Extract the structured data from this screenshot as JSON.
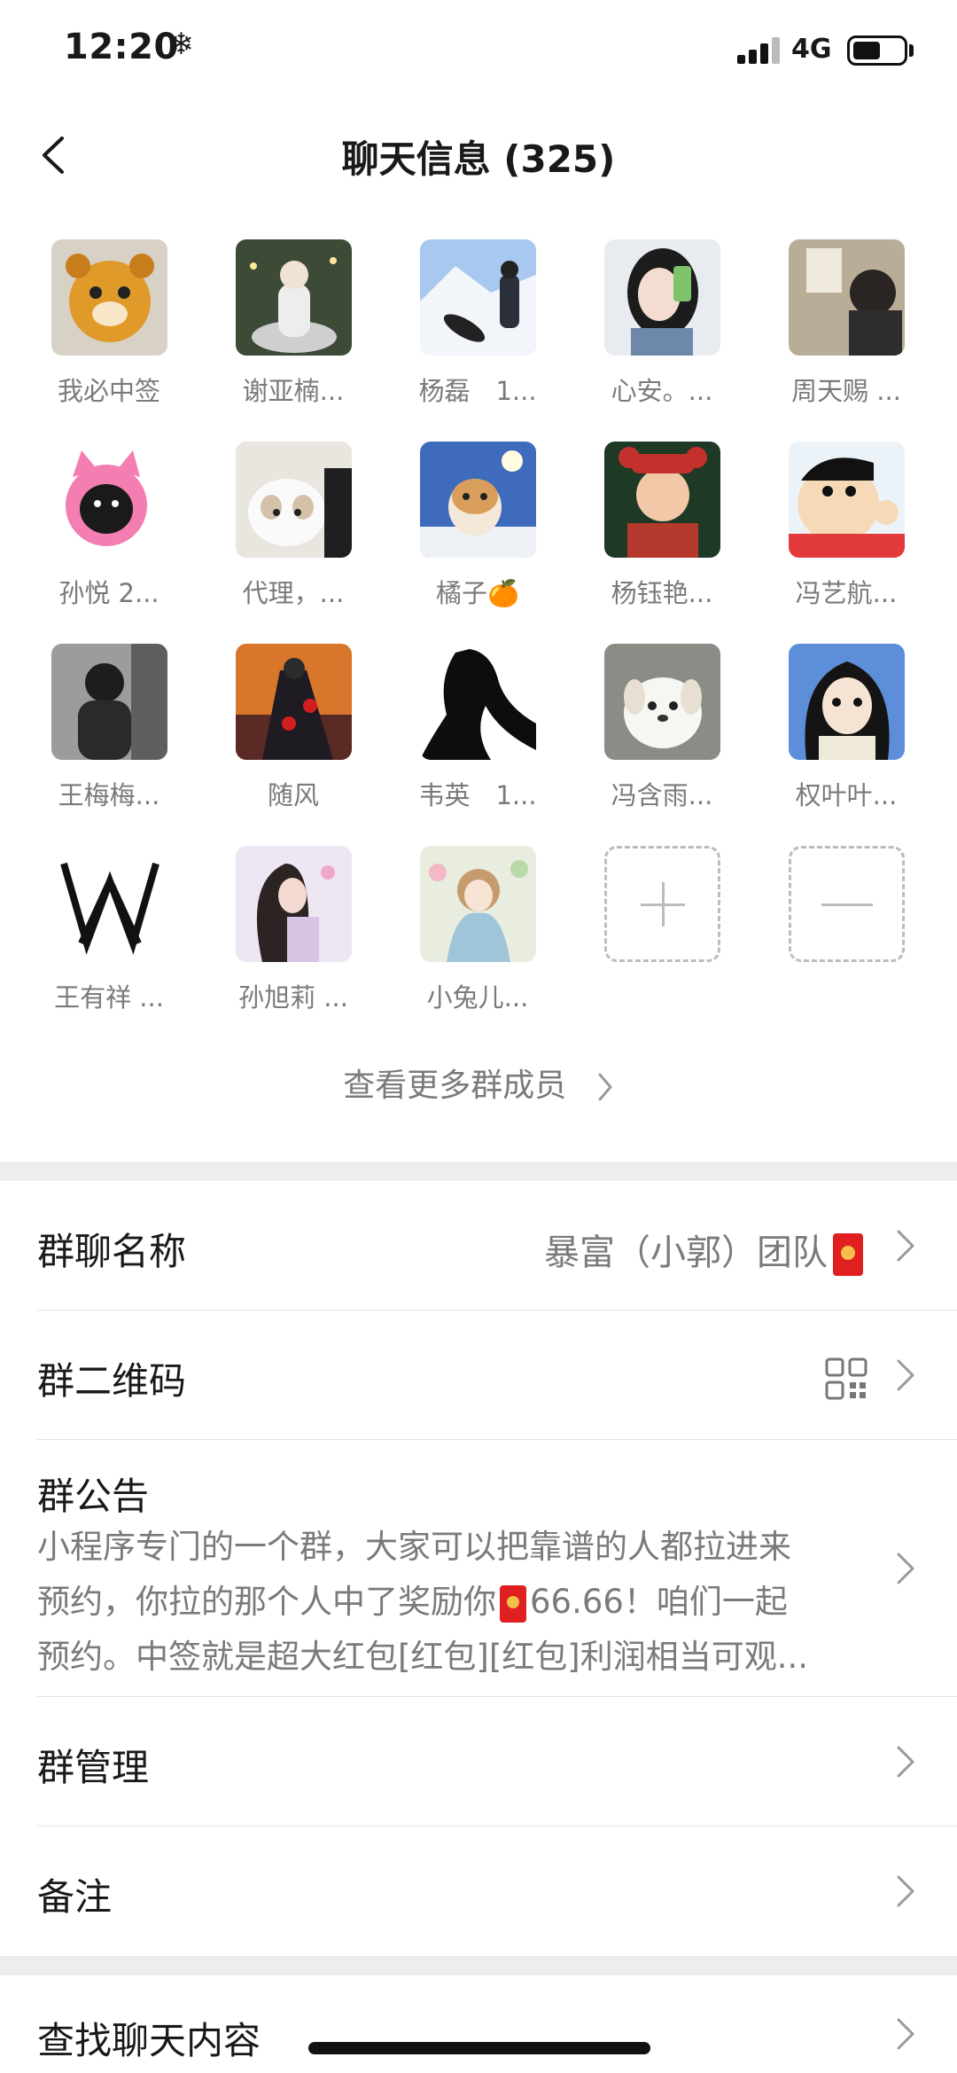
{
  "status_bar": {
    "time": "12:20",
    "extra_icon": "❄",
    "network": "4G"
  },
  "nav": {
    "title": "聊天信息 (325)"
  },
  "members": [
    {
      "name": "我必中签"
    },
    {
      "name": "谢亚楠..."
    },
    {
      "name": "杨磊　1..."
    },
    {
      "name": "心安。..."
    },
    {
      "name": "周天赐 ..."
    },
    {
      "name": "孙悦 2..."
    },
    {
      "name": "代理，..."
    },
    {
      "name": "橘子🍊"
    },
    {
      "name": "杨钰艳..."
    },
    {
      "name": "冯艺航..."
    },
    {
      "name": "王梅梅..."
    },
    {
      "name": "随风"
    },
    {
      "name": "韦英　1..."
    },
    {
      "name": "冯含雨..."
    },
    {
      "name": "权叶叶..."
    },
    {
      "name": "王有祥 ..."
    },
    {
      "name": "孙旭莉 ..."
    },
    {
      "name": "小兔儿..."
    }
  ],
  "more_members": "查看更多群成员",
  "settings": {
    "group_name_label": "群聊名称",
    "group_name_value": "暴富（小郭）团队",
    "qr_label": "群二维码",
    "notice_label": "群公告",
    "notice_line1": "小程序专门的一个群，大家可以把靠谱的人都拉进来",
    "notice_line2_a": "预约，你拉的那个人中了奖励你",
    "notice_line2_b": "66.66！咱们一起",
    "notice_line3": "预约。中签就是超大红包[红包][红包]利润相当可观...",
    "manage_label": "群管理",
    "remark_label": "备注",
    "search_label": "查找聊天内容"
  },
  "colors": {
    "accent_red": "#e02020",
    "gray_text": "#7a7a7a",
    "band": "#ededed"
  }
}
